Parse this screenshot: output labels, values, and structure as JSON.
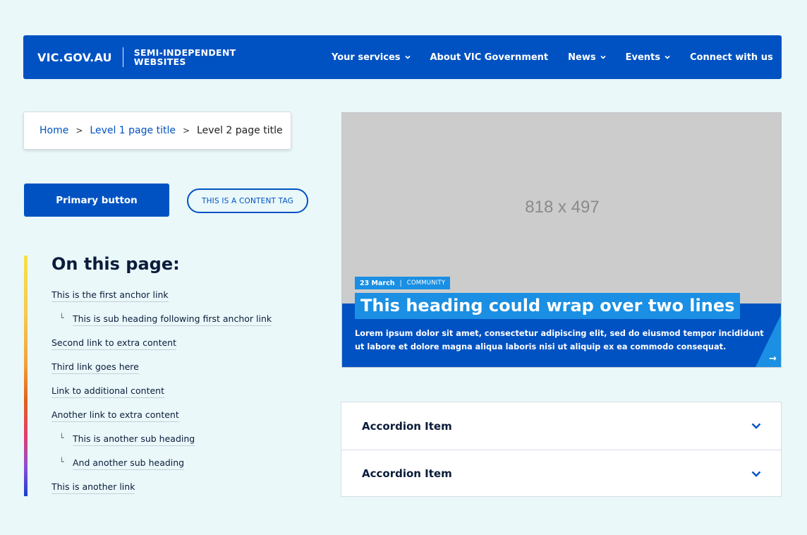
{
  "header": {
    "logo": "VIC.GOV.AU",
    "logo_sub": "SEMI-INDEPENDENT WEBSITES",
    "nav": [
      {
        "label": "Your services",
        "has_dropdown": true
      },
      {
        "label": "About VIC Government",
        "has_dropdown": false
      },
      {
        "label": "News",
        "has_dropdown": true
      },
      {
        "label": "Events",
        "has_dropdown": true
      },
      {
        "label": "Connect with us",
        "has_dropdown": false
      }
    ]
  },
  "breadcrumb": {
    "home": "Home",
    "level1": "Level 1 page title",
    "level2": "Level 2 page title",
    "separator": ">"
  },
  "buttons": {
    "primary": "Primary button",
    "content_tag": "THIS IS A CONTENT TAG"
  },
  "on_this_page": {
    "title": "On this page:",
    "links": [
      {
        "label": "This is the first anchor link",
        "sub": false
      },
      {
        "label": "This is sub heading following first anchor link",
        "sub": true
      },
      {
        "label": "Second link to extra content",
        "sub": false
      },
      {
        "label": "Third link goes here",
        "sub": false
      },
      {
        "label": "Link to additional content",
        "sub": false
      },
      {
        "label": "Another link to extra content",
        "sub": false
      },
      {
        "label": "This is another sub heading",
        "sub": true
      },
      {
        "label": "And another sub heading",
        "sub": true
      },
      {
        "label": "This is another link",
        "sub": false
      }
    ]
  },
  "card": {
    "image_placeholder": "818 x 497",
    "date": "23 March",
    "category": "COMMUNITY",
    "heading": "This heading could wrap over two lines",
    "body": "Lorem ipsum dolor sit amet, consectetur adipiscing elit, sed do eiusmod tempor incididunt ut labore et dolore magna aliqua laboris nisi ut aliquip ex ea commodo consequat.",
    "arrow_icon": "arrow-right-icon"
  },
  "accordion": {
    "items": [
      {
        "label": "Accordion Item"
      },
      {
        "label": "Accordion Item"
      }
    ]
  },
  "colors": {
    "primary": "#0052c2",
    "accent": "#1a8fe3",
    "background": "#eaf8fa"
  }
}
